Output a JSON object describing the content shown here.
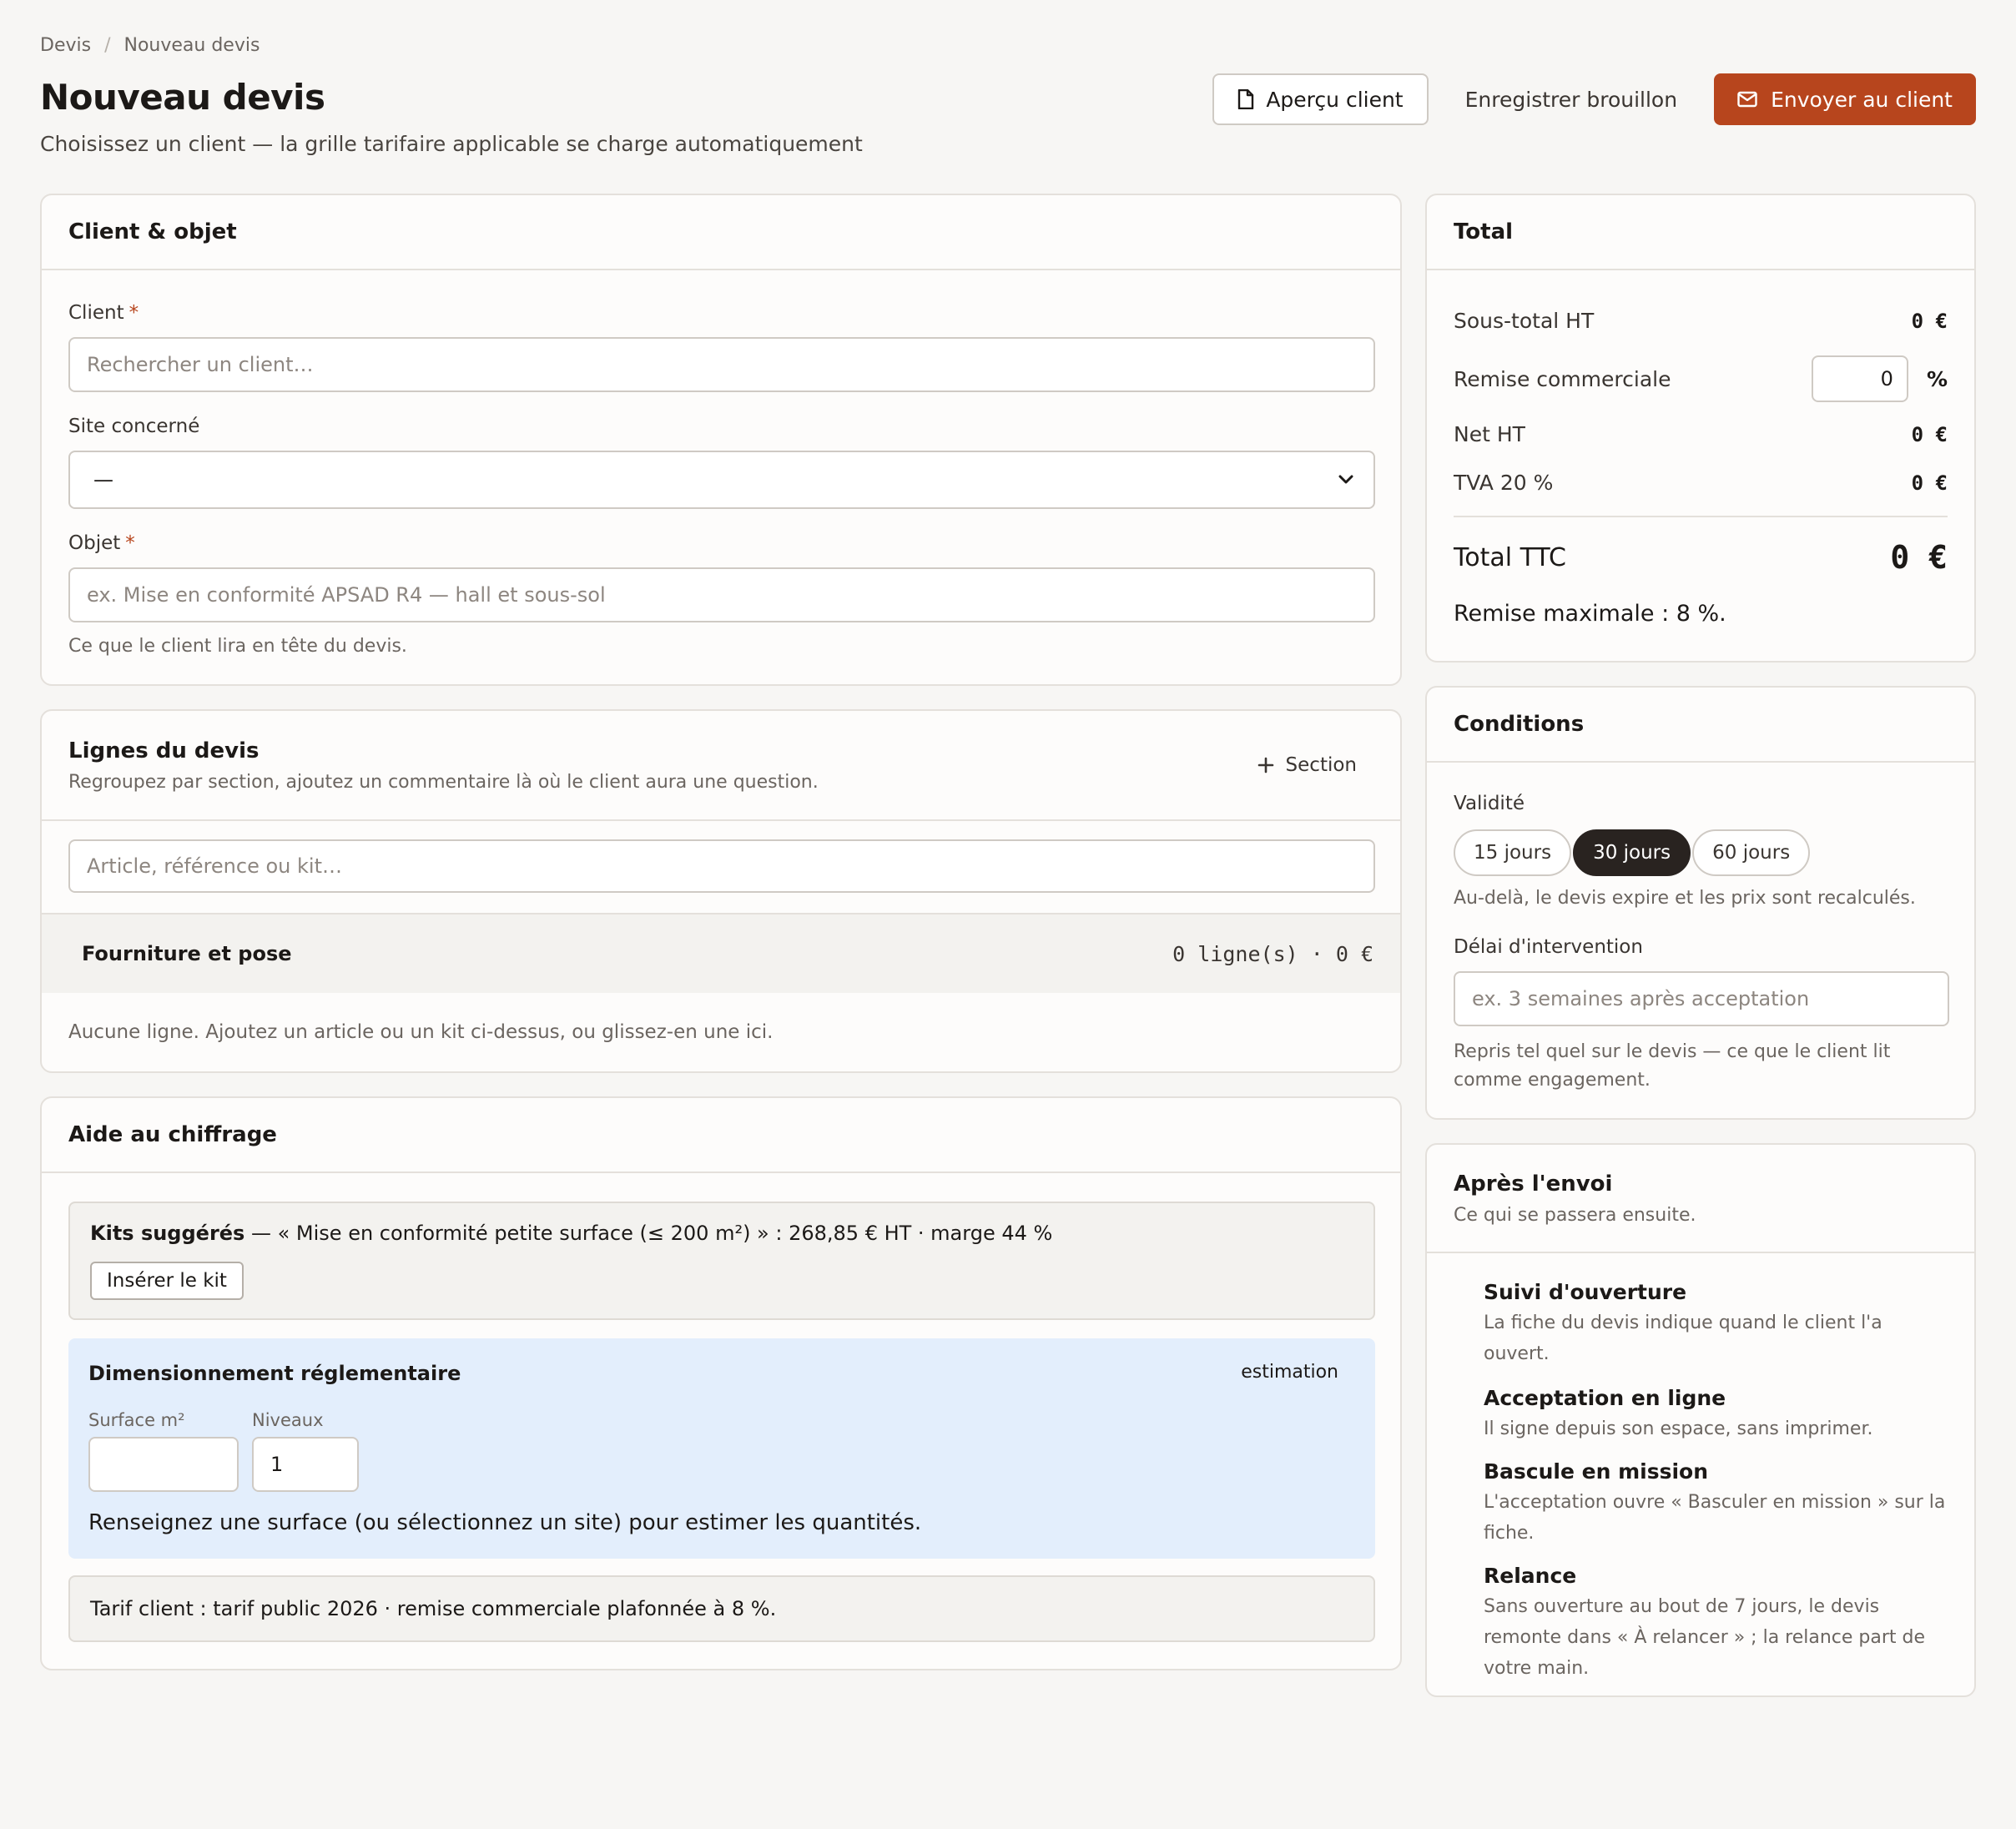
{
  "breadcrumb": {
    "root": "Devis",
    "separator": "/",
    "current": "Nouveau devis"
  },
  "header": {
    "title": "Nouveau devis",
    "subtitle": "Choisissez un client — la grille tarifaire applicable se charge automatiquement",
    "preview_label": "Aperçu client",
    "draft_label": "Enregistrer brouillon",
    "send_label": "Envoyer au client"
  },
  "client_card": {
    "title": "Client & objet",
    "client_label": "Client",
    "required_mark": "*",
    "client_placeholder": "Rechercher un client…",
    "site_label": "Site concerné",
    "site_value": "—",
    "object_label": "Objet",
    "object_placeholder": "ex. Mise en conformité APSAD R4 — hall et sous-sol",
    "object_hint": "Ce que le client lira en tête du devis."
  },
  "lines_card": {
    "title": "Lignes du devis",
    "description": "Regroupez par section, ajoutez un commentaire là où le client aura une question.",
    "add_section_label": "Section",
    "search_placeholder": "Article, référence ou kit…",
    "section_name": "Fourniture et pose",
    "section_summary": "0 ligne(s) · 0 €",
    "empty_text": "Aucune ligne. Ajoutez un article ou un kit ci-dessus, ou glissez-en une ici."
  },
  "help_card": {
    "title": "Aide au chiffrage",
    "kits_bold": "Kits suggérés",
    "kits_text": " — « Mise en conformité petite surface (≤ 200 m²) » : 268,85 € HT · marge 44 %",
    "insert_kit_label": "Insérer le kit",
    "sizing_title": "Dimensionnement réglementaire",
    "sizing_badge": "estimation",
    "surface_label": "Surface m²",
    "surface_value": "",
    "levels_label": "Niveaux",
    "levels_value": "1",
    "sizing_hint": "Renseignez une surface (ou sélectionnez un site) pour estimer les quantités.",
    "tariff_text": "Tarif client : tarif public 2026 · remise commerciale plafonnée à 8 %."
  },
  "total_card": {
    "title": "Total",
    "subtotal_label": "Sous-total HT",
    "subtotal_value": "0 €",
    "discount_label": "Remise commerciale",
    "discount_value": "0",
    "discount_unit": "%",
    "net_label": "Net HT",
    "net_value": "0 €",
    "vat_label": "TVA 20 %",
    "vat_value": "0 €",
    "ttc_label": "Total TTC",
    "ttc_value": "0 €",
    "max_discount": "Remise maximale : 8 %."
  },
  "conditions_card": {
    "title": "Conditions",
    "validity_label": "Validité",
    "validity_options": [
      "15 jours",
      "30 jours",
      "60 jours"
    ],
    "validity_selected": "30 jours",
    "validity_hint": "Au-delà, le devis expire et les prix sont recalculés.",
    "delay_label": "Délai d'intervention",
    "delay_placeholder": "ex. 3 semaines après acceptation",
    "delay_hint": "Repris tel quel sur le devis — ce que le client lit comme engagement."
  },
  "after_card": {
    "title": "Après l'envoi",
    "description": "Ce qui se passera ensuite.",
    "steps": [
      {
        "title": "Suivi d'ouverture",
        "text": "La fiche du devis indique quand le client l'a ouvert."
      },
      {
        "title": "Acceptation en ligne",
        "text": "Il signe depuis son espace, sans imprimer."
      },
      {
        "title": "Bascule en mission",
        "text": "L'acceptation ouvre « Basculer en mission » sur la fiche."
      },
      {
        "title": "Relance",
        "text": "Sans ouverture au bout de 7 jours, le devis remonte dans « À relancer » ; la relance part de votre main."
      }
    ]
  },
  "colors": {
    "accent": "#b7451d",
    "selected_pill": "#292320",
    "info_bg": "#e3eefc",
    "muted_bg": "#f3f2ef"
  }
}
